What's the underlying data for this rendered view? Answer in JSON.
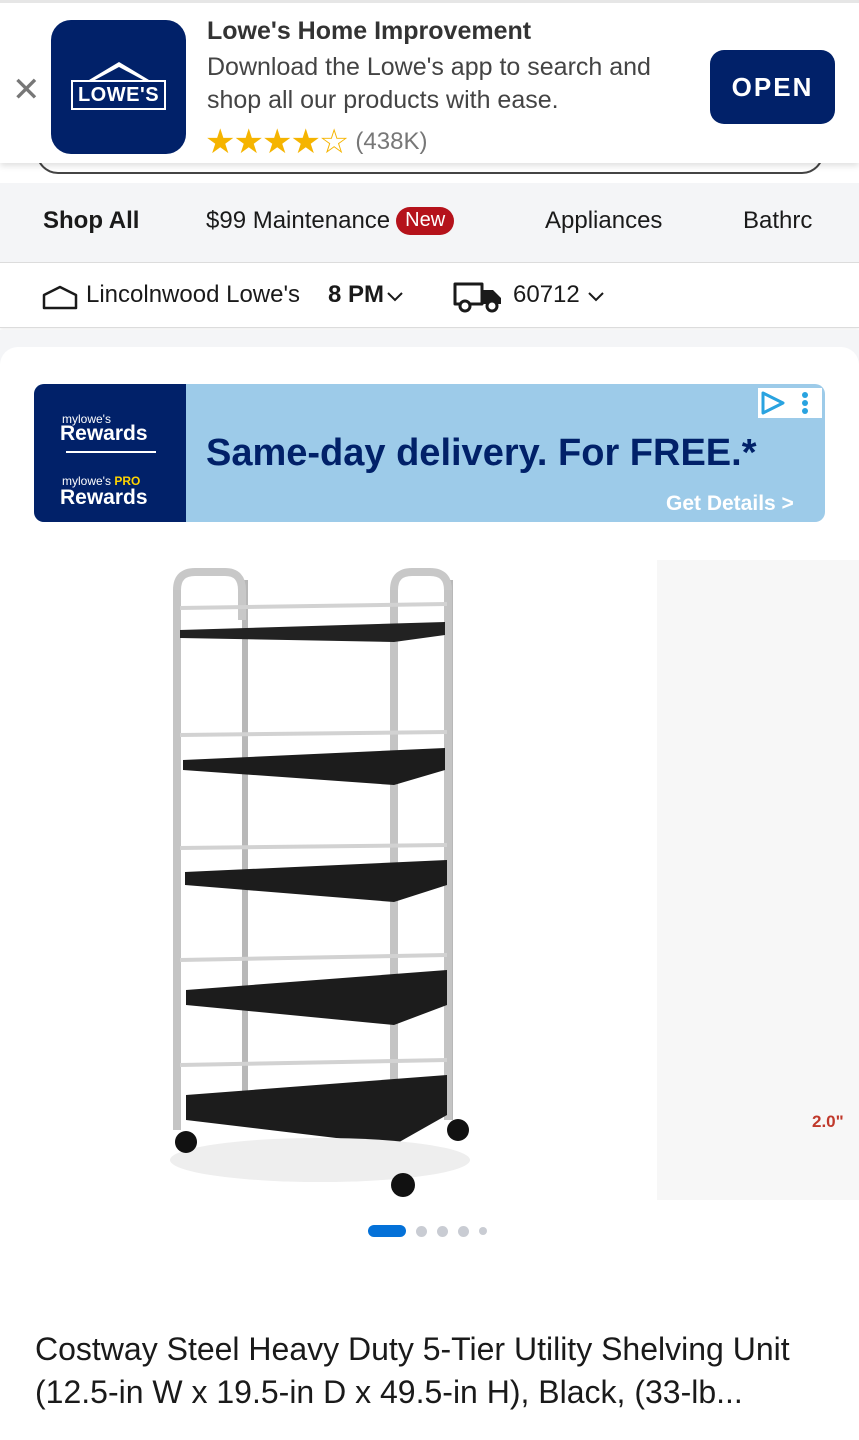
{
  "app_banner": {
    "close_icon": "close-icon",
    "logo_text": "LOWE'S",
    "title": "Lowe's Home Improvement",
    "description": "Download the Lowe's app to search and shop all our products with ease.",
    "stars": "★★★★☆",
    "rating": 4.5,
    "rating_count": "(438K)",
    "open_label": "OPEN",
    "brand_color": "#012169",
    "star_color": "#f5b400"
  },
  "categories": {
    "items": [
      {
        "label": "Shop All"
      },
      {
        "label": "$99 Maintenance",
        "badge": "New"
      },
      {
        "label": "Appliances"
      },
      {
        "label": "Bathrc"
      }
    ]
  },
  "store": {
    "name": "Lincolnwood Lowe's",
    "hours": "8 PM",
    "zip": "60712",
    "store_icon": "store-icon",
    "truck_icon": "truck-icon"
  },
  "ad": {
    "rewards_small": "mylowe's",
    "rewards": "Rewards",
    "pro_small": "mylowe's",
    "pro_label": "PRO",
    "pro_rewards": "Rewards",
    "headline": "Same-day delivery. For FREE.*",
    "cta": "Get Details >",
    "background": "#9dcbe9"
  },
  "gallery": {
    "next_image_label": "2.0\"",
    "slide_count": 5,
    "active_slide": 1,
    "accent": "#0471d8"
  },
  "product": {
    "title": "Costway Steel Heavy Duty 5-Tier Utility Shelving Unit (12.5-in W x 19.5-in D x 49.5-in H), Black, (33-lb..."
  }
}
